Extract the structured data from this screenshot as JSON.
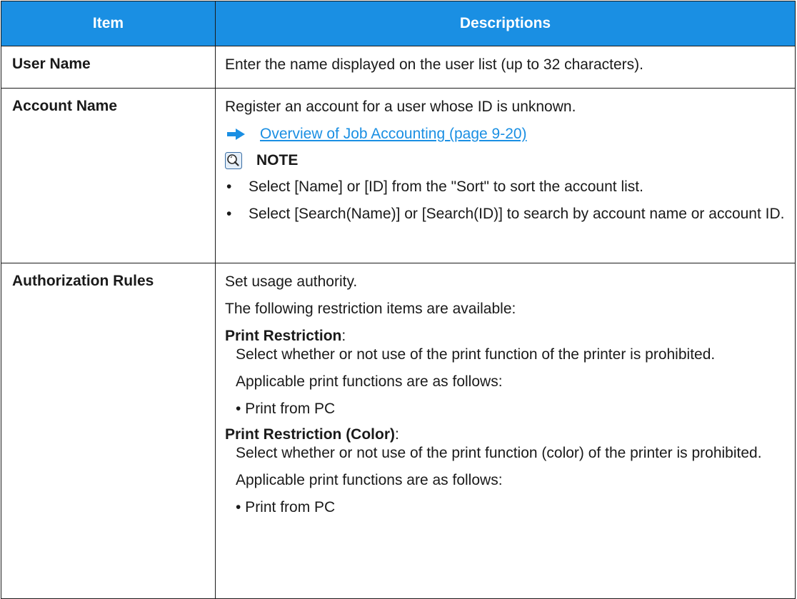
{
  "header": {
    "item": "Item",
    "descriptions": "Descriptions"
  },
  "rows": {
    "user_name": {
      "item": "User Name",
      "description": "Enter the name displayed on the user list (up to 32 characters)."
    },
    "account_name": {
      "item": "Account Name",
      "description": "Register an account for a user whose ID is unknown.",
      "link": "Overview of Job Accounting (page 9-20)",
      "note_label": "NOTE",
      "notes": [
        "Select [Name] or [ID] from the \"Sort\" to sort the account list.",
        "Select [Search(Name)] or [Search(ID)] to search by account name or account ID."
      ]
    },
    "authorization_rules": {
      "item": "Authorization Rules",
      "line1": "Set usage authority.",
      "line2": "The following restriction items are available:",
      "restrictions": [
        {
          "title": "Print Restriction",
          "colon": ":",
          "text": "Select whether or not use of the print function of the printer is prohibited.",
          "functions_intro": "Applicable print functions are as follows:",
          "function": "• Print from PC"
        },
        {
          "title": "Print Restriction (Color)",
          "colon": ":",
          "text": "Select whether or not use of the print function (color) of the printer is prohibited.",
          "functions_intro": "Applicable print functions are as follows:",
          "function": "• Print from PC"
        }
      ]
    }
  },
  "colors": {
    "header_bg": "#1a8fe3",
    "link": "#1a8fe3",
    "border": "#1a1a1a"
  },
  "icons": {
    "link_arrow": "right-arrow-icon",
    "note": "lightbulb-note-icon",
    "bullet": "bullet-dot"
  }
}
